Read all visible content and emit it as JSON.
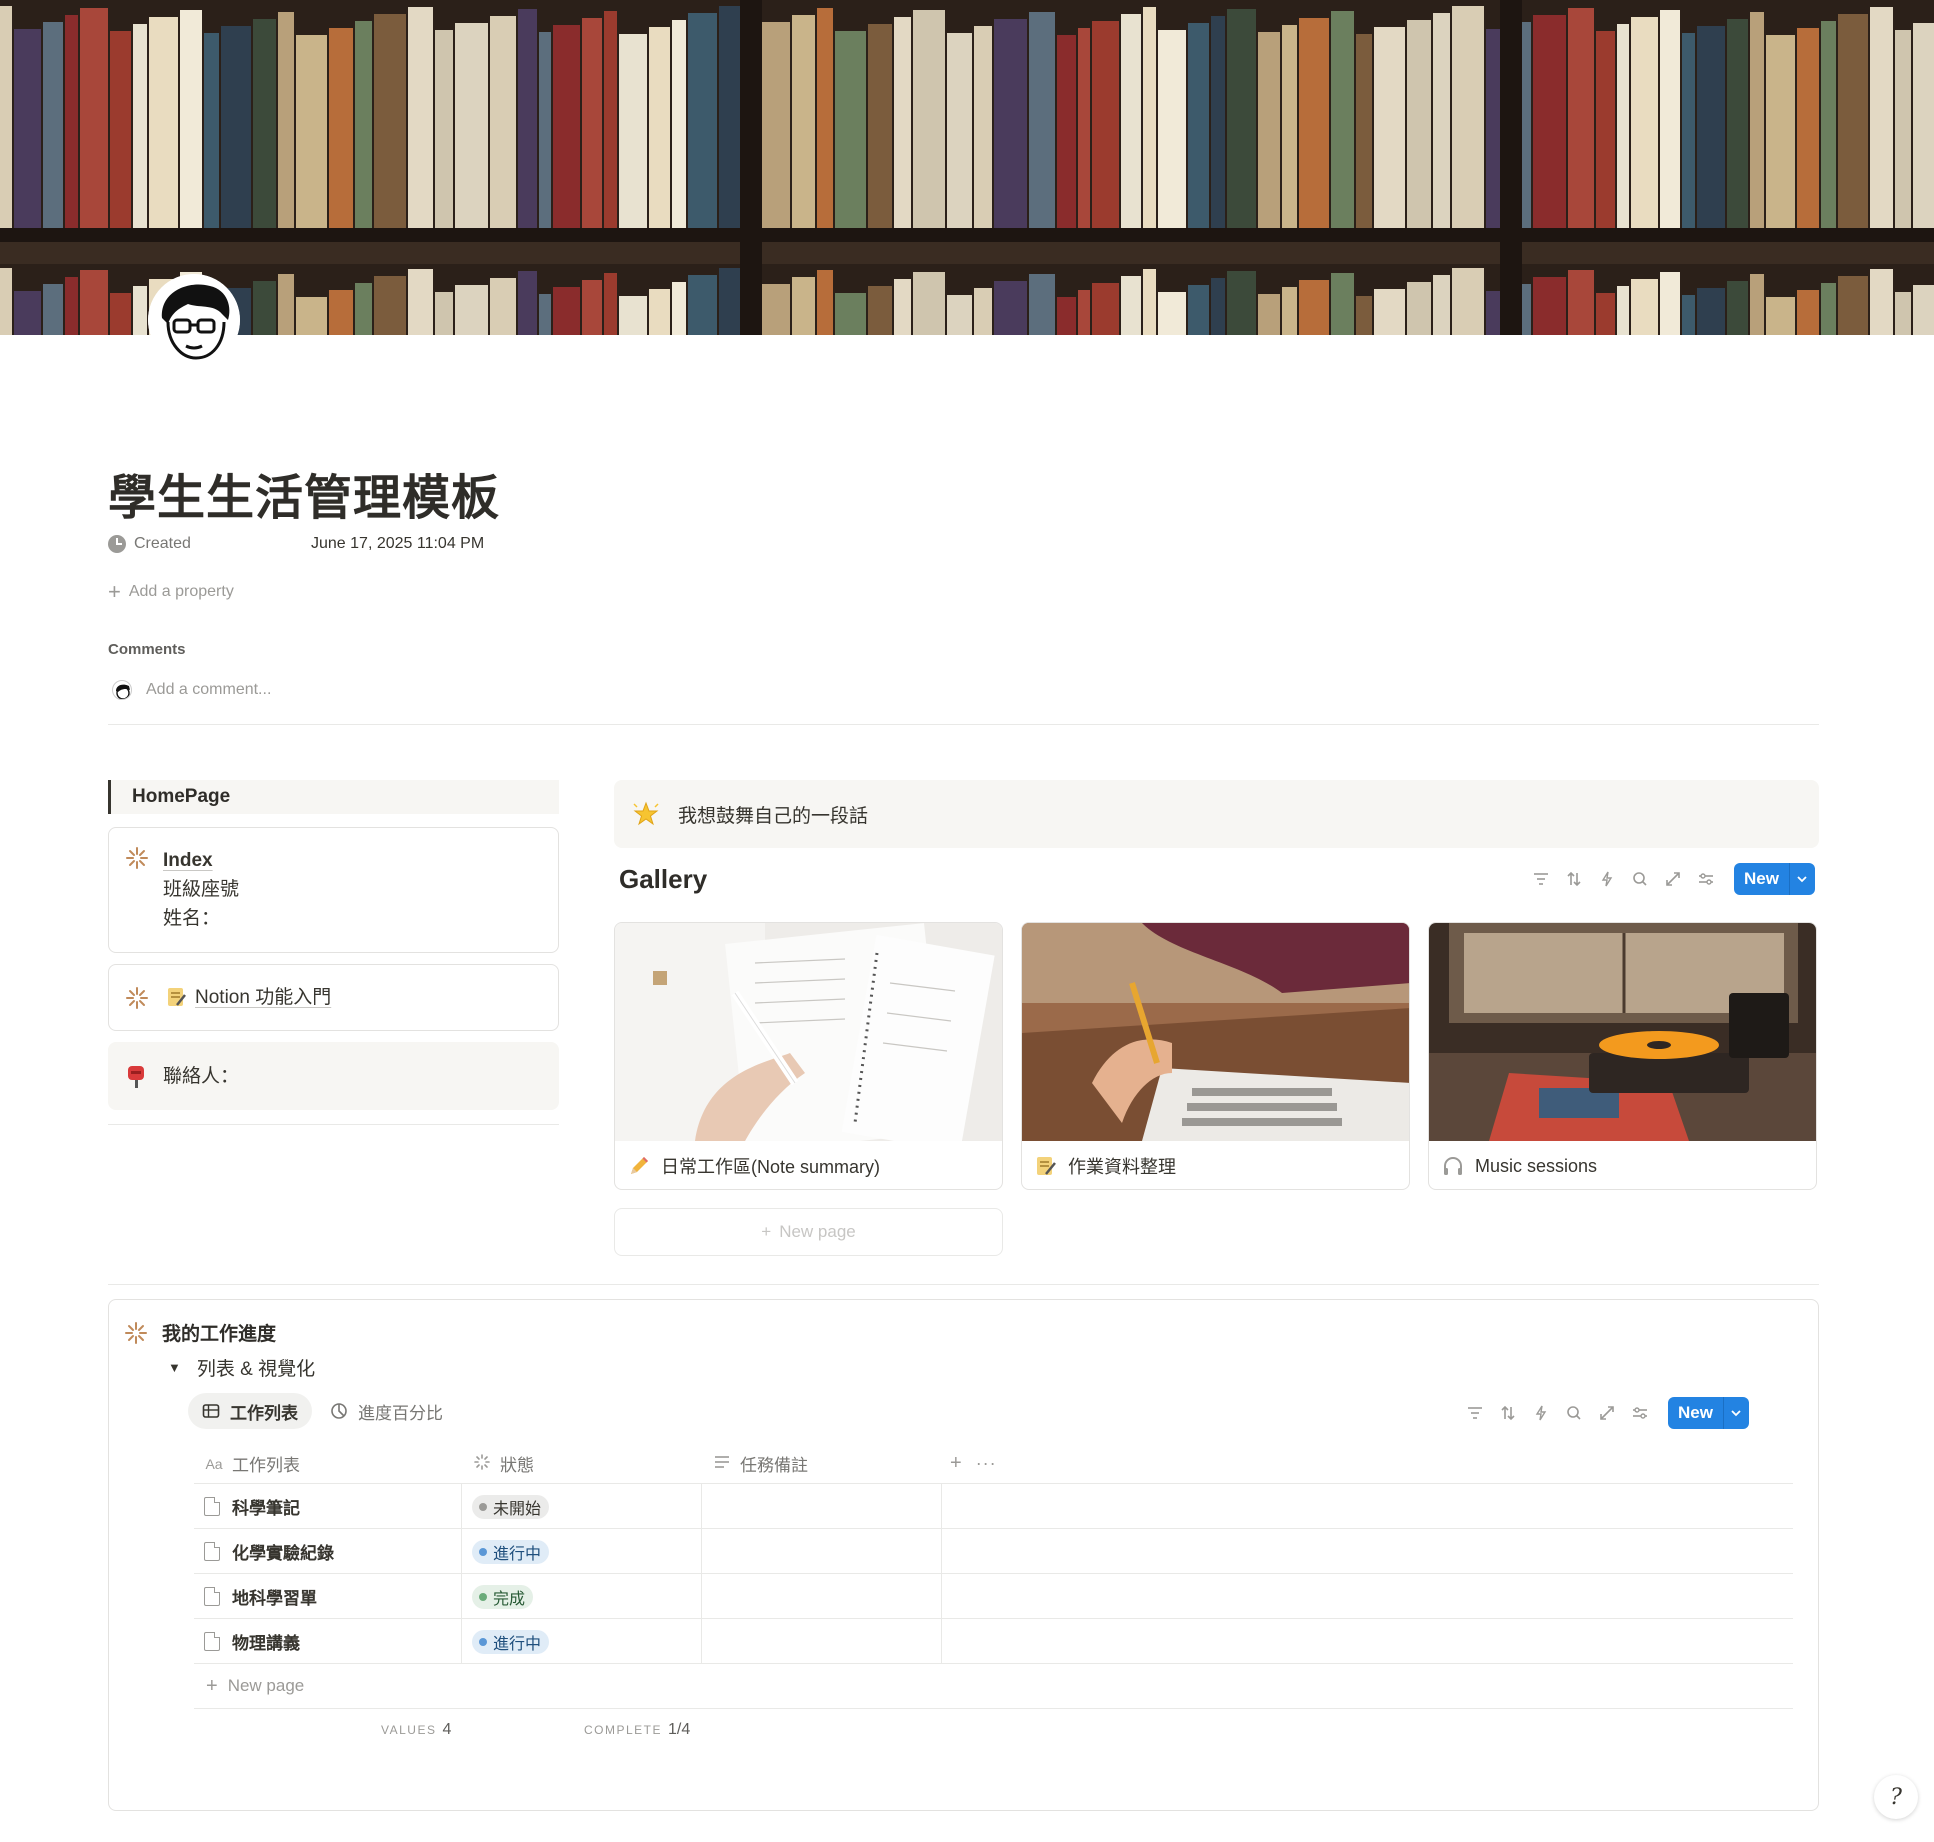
{
  "page": {
    "title": "學生生活管理模板",
    "properties": [
      {
        "name": "Created",
        "value": "June 17, 2025 11:04 PM",
        "icon": "clock-icon"
      }
    ],
    "add_property": "Add a property",
    "comments_label": "Comments",
    "add_comment_placeholder": "Add a comment..."
  },
  "left": {
    "homepage_heading": "HomePage",
    "index_card": {
      "title": "Index",
      "lines": [
        "班級座號",
        "姓名："
      ]
    },
    "notion_card": {
      "link": "Notion 功能入門"
    },
    "contact_card": {
      "text": "聯絡人："
    }
  },
  "callout": {
    "text": "我想鼓舞自己的一段話",
    "icon": "glowing-star-icon"
  },
  "gallery": {
    "title": "Gallery",
    "new_label": "New",
    "new_page": "New page",
    "cards": [
      {
        "title": "日常工作區(Note summary)",
        "icon": "pencil-icon"
      },
      {
        "title": "作業資料整理",
        "icon": "memo-icon"
      },
      {
        "title": "Music sessions",
        "icon": "headphones-icon"
      }
    ]
  },
  "progress": {
    "title": "我的工作進度",
    "toggle_label": "列表 & 視覺化",
    "views": [
      {
        "label": "工作列表",
        "icon": "table-icon",
        "active": true
      },
      {
        "label": "進度百分比",
        "icon": "pie-chart-icon",
        "active": false
      }
    ],
    "new_label": "New",
    "columns": [
      {
        "label": "工作列表",
        "icon": "Aa"
      },
      {
        "label": "狀態",
        "icon": "status-icon"
      },
      {
        "label": "任務備註",
        "icon": "text-lines-icon"
      }
    ],
    "rows": [
      {
        "name": "科學筆記",
        "status": "未開始",
        "status_key": "todo"
      },
      {
        "name": "化學實驗紀錄",
        "status": "進行中",
        "status_key": "doing"
      },
      {
        "name": "地科學習單",
        "status": "完成",
        "status_key": "done"
      },
      {
        "name": "物理講義",
        "status": "進行中",
        "status_key": "doing"
      }
    ],
    "new_page": "New page",
    "calc": {
      "values_label": "VALUES",
      "values": "4",
      "complete_label": "COMPLETE",
      "complete": "1/4"
    }
  },
  "status_colors": {
    "todo": {
      "bg": "#ebebea",
      "dot": "#9b9a97",
      "text": "#37352f"
    },
    "doing": {
      "bg": "#e0ecf7",
      "dot": "#5a97d6",
      "text": "#1f4f7d"
    },
    "done": {
      "bg": "#e5f0e7",
      "dot": "#6aab79",
      "text": "#285a35"
    }
  },
  "accent": "#2383e2"
}
